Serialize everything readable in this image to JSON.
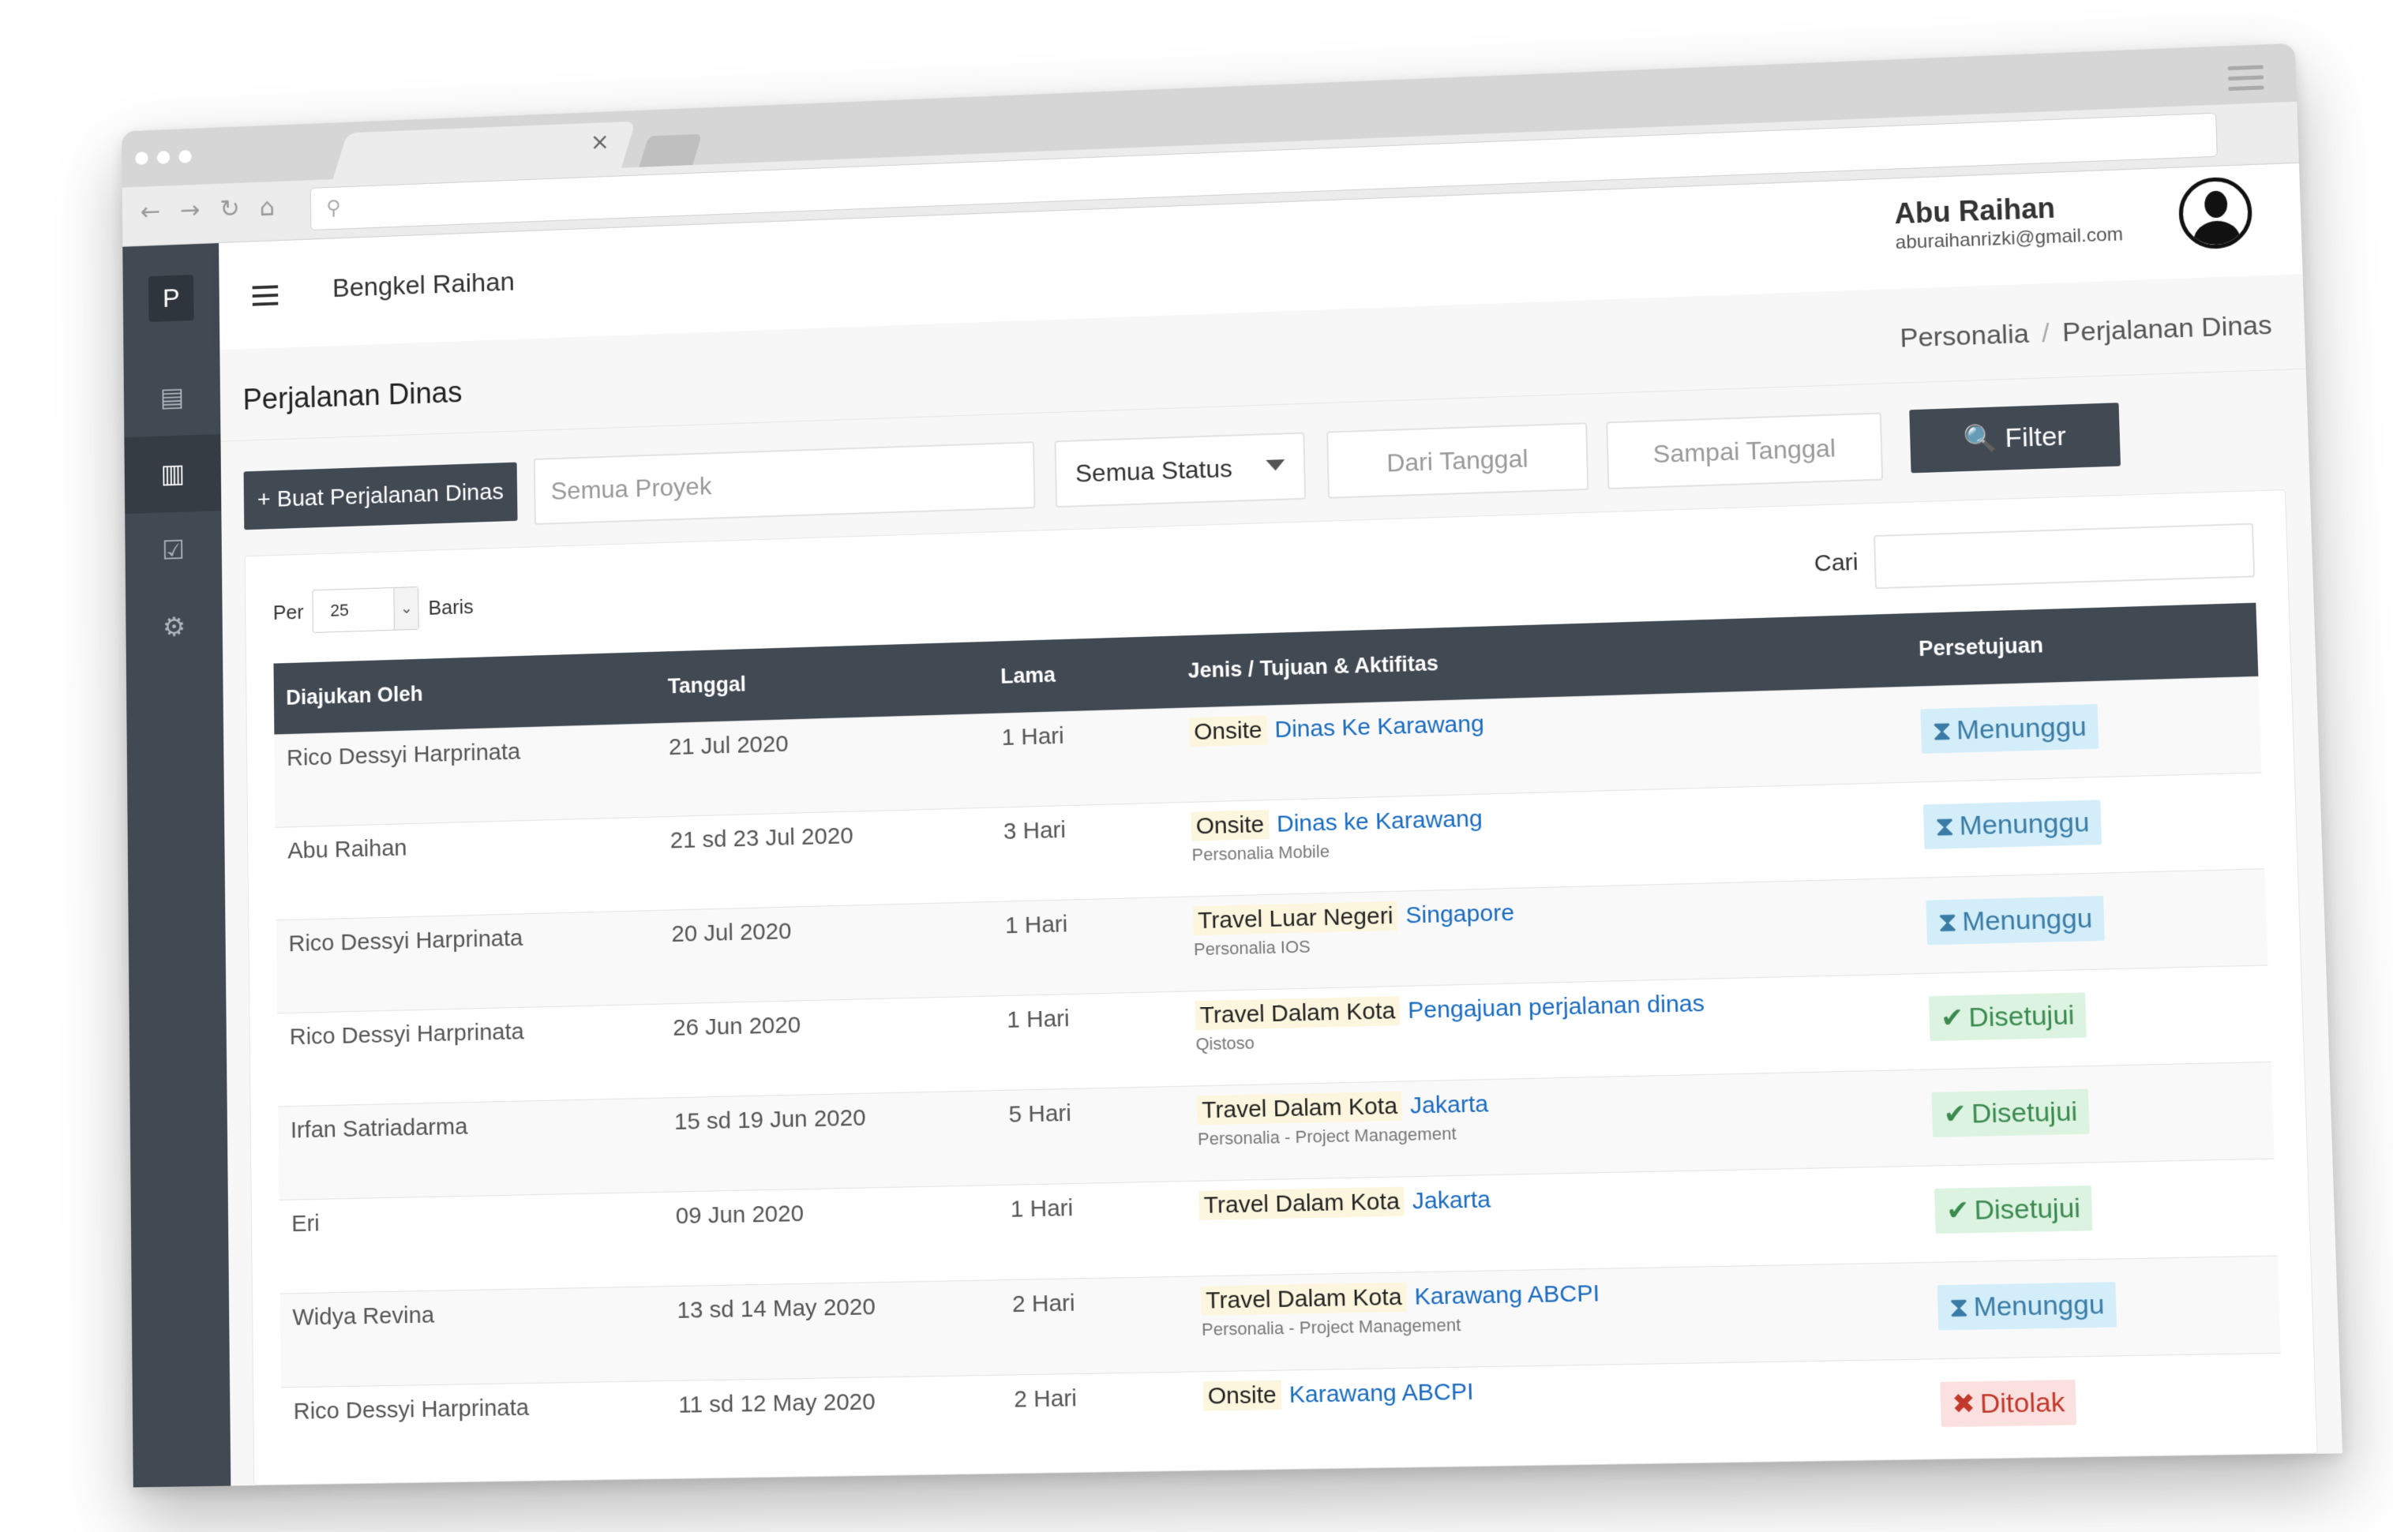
{
  "header": {
    "company": "Bengkel Raihan",
    "user_name": "Abu Raihan",
    "user_email": "aburaihanrizki@gmail.com"
  },
  "sidebar": {
    "logo": "P",
    "items": [
      {
        "icon": "id-card-icon",
        "glyph": "▤"
      },
      {
        "icon": "clipboard-icon",
        "glyph": "▥"
      },
      {
        "icon": "clipboard-check-icon",
        "glyph": "☑"
      },
      {
        "icon": "gear-icon",
        "glyph": "⚙"
      }
    ]
  },
  "page": {
    "title": "Perjalanan Dinas",
    "breadcrumb": [
      "Personalia",
      "Perjalanan Dinas"
    ]
  },
  "toolbar": {
    "create_label": "+ Buat Perjalanan Dinas",
    "project_placeholder": "Semua Proyek",
    "status_value": "Semua Status",
    "from_date": "Dari Tanggal",
    "to_date": "Sampai Tanggal",
    "filter_label": "🔍 Filter"
  },
  "table_controls": {
    "per_label": "Per",
    "per_value": "25",
    "rows_label": "Baris",
    "search_label": "Cari"
  },
  "table": {
    "columns": [
      "Diajukan Oleh",
      "Tanggal",
      "Lama",
      "Jenis / Tujuan & Aktifitas",
      "Persetujuan"
    ],
    "rows": [
      {
        "by": "Rico Dessyi Harprinata",
        "date": "21 Jul 2020",
        "duration": "1 Hari",
        "type": "Onsite",
        "dest": "Dinas Ke Karawang",
        "sub": "",
        "status": "Menunggu",
        "status_kind": "wait"
      },
      {
        "by": "Abu Raihan",
        "date": "21 sd 23 Jul 2020",
        "duration": "3 Hari",
        "type": "Onsite",
        "dest": "Dinas ke Karawang",
        "sub": "Personalia Mobile",
        "status": "Menunggu",
        "status_kind": "wait"
      },
      {
        "by": "Rico Dessyi Harprinata",
        "date": "20 Jul 2020",
        "duration": "1 Hari",
        "type": "Travel Luar Negeri",
        "dest": "Singapore",
        "sub": "Personalia IOS",
        "status": "Menunggu",
        "status_kind": "wait"
      },
      {
        "by": "Rico Dessyi Harprinata",
        "date": "26 Jun 2020",
        "duration": "1 Hari",
        "type": "Travel Dalam Kota",
        "dest": "Pengajuan perjalanan dinas",
        "sub": "Qistoso",
        "status": "Disetujui",
        "status_kind": "ok"
      },
      {
        "by": "Irfan Satriadarma",
        "date": "15 sd 19 Jun 2020",
        "duration": "5 Hari",
        "type": "Travel Dalam Kota",
        "dest": "Jakarta",
        "sub": "Personalia - Project Management",
        "status": "Disetujui",
        "status_kind": "ok"
      },
      {
        "by": "Eri",
        "date": "09 Jun 2020",
        "duration": "1 Hari",
        "type": "Travel Dalam Kota",
        "dest": "Jakarta",
        "sub": "",
        "status": "Disetujui",
        "status_kind": "ok"
      },
      {
        "by": "Widya Revina",
        "date": "13 sd 14 May 2020",
        "duration": "2 Hari",
        "type": "Travel Dalam Kota",
        "dest": "Karawang ABCPI",
        "sub": "Personalia - Project Management",
        "status": "Menunggu",
        "status_kind": "wait"
      },
      {
        "by": "Rico Dessyi Harprinata",
        "date": "11 sd 12 May 2020",
        "duration": "2 Hari",
        "type": "Onsite",
        "dest": "Karawang ABCPI",
        "sub": "",
        "status": "Ditolak",
        "status_kind": "no"
      }
    ]
  },
  "colors": {
    "sidebar": "#414953",
    "link": "#1a6bbf",
    "badge_wait": "#d4eef9",
    "badge_ok": "#dbf3e0",
    "badge_no": "#fbe0e0"
  }
}
